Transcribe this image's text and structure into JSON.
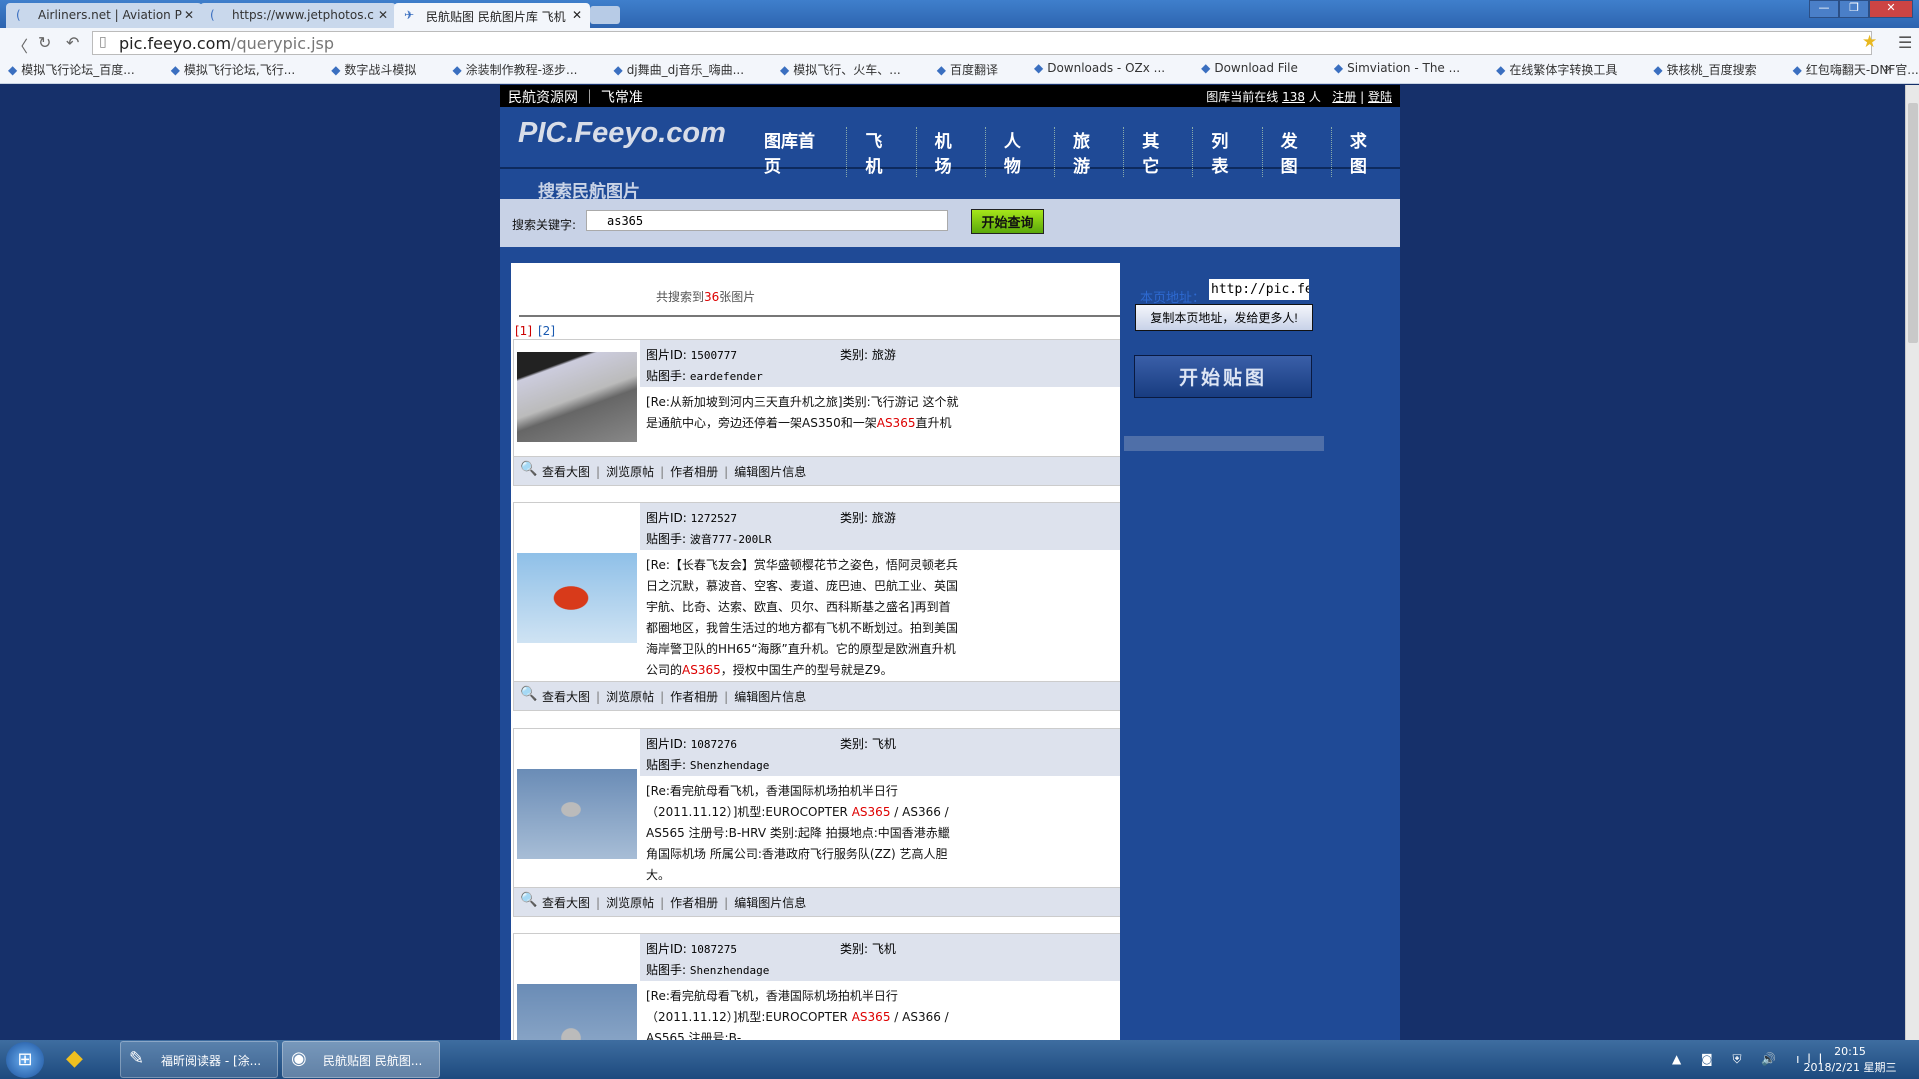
{
  "browser": {
    "tabs": [
      {
        "title": "Airliners.net | Aviation P",
        "active": false
      },
      {
        "title": "https://www.jetphotos.c",
        "active": false
      },
      {
        "title": "民航贴图 民航图片库 飞机",
        "active": true
      }
    ],
    "url_host": "pic.feeyo.com",
    "url_path": "/querypic.jsp",
    "bookmarks": [
      "模拟飞行论坛_百度...",
      "模拟飞行论坛,飞行...",
      "数字战斗模拟",
      "涂装制作教程-逐步...",
      "dj舞曲_dj音乐_嗨曲...",
      "模拟飞行、火车、...",
      "百度翻译",
      "Downloads - OZx ...",
      "Download File",
      "Simviation - The ...",
      "在线繁体字转换工具",
      "铁核桃_百度搜索",
      "红包嗨翻天-DNF官..."
    ],
    "more": "»"
  },
  "topbar": {
    "left": "民航资源网 ｜ 飞常准",
    "online_label": "图库当前在线",
    "online_count": "138",
    "online_unit": "人",
    "register": "注册",
    "login": "登陆"
  },
  "header": {
    "logo": "PIC.Feeyo.com",
    "nav": [
      "图库首页",
      "飞机",
      "机场",
      "人物",
      "旅游",
      "其它",
      "列表",
      "发图",
      "求图"
    ]
  },
  "search": {
    "title": "搜索民航图片",
    "label": "搜索关键字:",
    "value": "as365",
    "button": "开始查询"
  },
  "results": {
    "prefix": "共搜索到",
    "count": "36",
    "suffix": "张图片",
    "pages": [
      "[1]",
      "[2]"
    ],
    "id_label": "图片ID:",
    "cat_label": "类别:",
    "poster_label": "贴图手:",
    "actions": [
      "查看大图",
      "浏览原帖",
      "作者相册",
      "编辑图片信息"
    ],
    "items": [
      {
        "id": "1500777",
        "category": "旅游",
        "poster": "eardefender",
        "desc_before": "[Re:从新加坡到河内三天直升机之旅]类别:飞行游记 这个就是通航中心，旁边还停着一架AS350和一架",
        "highlight": "AS365",
        "desc_after": "直升机"
      },
      {
        "id": "1272527",
        "category": "旅游",
        "poster": "波音777-200LR",
        "desc_before": "[Re:【长春飞友会】赏华盛顿樱花节之姿色，悟阿灵顿老兵日之沉默，慕波音、空客、麦道、庞巴迪、巴航工业、英国宇航、比奇、达索、欧直、贝尔、西科斯基之盛名]再到首都圈地区，我曾生活过的地方都有飞机不断划过。拍到美国海岸警卫队的HH65“海豚”直升机。它的原型是欧洲直升机公司的",
        "highlight": "AS365",
        "desc_after": "，授权中国生产的型号就是Z9。"
      },
      {
        "id": "1087276",
        "category": "飞机",
        "poster": "Shenzhendage",
        "desc_before": "[Re:看完航母看飞机，香港国际机场拍机半日行（2011.11.12）]机型:EUROCOPTER ",
        "highlight": "AS365",
        "desc_after": " / AS366 / AS565 注册号:B-HRV 类别:起降 拍摄地点:中国香港赤鱲角国际机场 所属公司:香港政府飞行服务队(ZZ) 艺高人胆大。"
      },
      {
        "id": "1087275",
        "category": "飞机",
        "poster": "Shenzhendage",
        "desc_before": "[Re:看完航母看飞机，香港国际机场拍机半日行（2011.11.12）]机型:EUROCOPTER ",
        "highlight": "AS365",
        "desc_after": " / AS366 / AS565 注册号:B-"
      }
    ]
  },
  "side": {
    "url_label": "本页地址：",
    "url_value": "http://pic.feeyo.com/querypic.jsp",
    "copy_button": "复制本页地址，发给更多人!",
    "post_button": "开始贴图"
  },
  "taskbar": {
    "apps": [
      "福昕阅读器 - [涂...",
      "民航贴图 民航图..."
    ],
    "time": "20:15",
    "date": "2018/2/21 星期三"
  }
}
